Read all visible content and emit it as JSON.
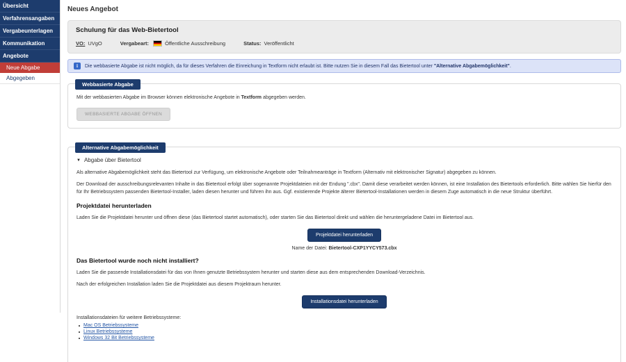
{
  "colors": {
    "navy": "#1d3c6d",
    "red": "#c13e38",
    "link": "#2456a5",
    "banner_bg": "#dce3f8",
    "banner_border": "#aebbea",
    "info_icon_bg": "#3568c9"
  },
  "icons": {
    "info_glyph": "i",
    "collapse_arrow": "▼"
  },
  "sidebar": {
    "items": [
      "Übersicht",
      "Verfahrensangaben",
      "Vergabeunterlagen",
      "Kommunikation",
      "Angebote"
    ],
    "sub_items": [
      {
        "label": "Neue Abgabe",
        "active": true
      },
      {
        "label": "Abgegeben",
        "active": false
      }
    ]
  },
  "header": {
    "page_title": "Neues Angebot",
    "procedure_title": "Schulung für das Web-Bietertool",
    "vo_label": "VO:",
    "vo_value": "UVgO",
    "vergabeart_label": "Vergabeart:",
    "vergabeart_value": "Öffentliche Ausschreibung",
    "status_label": "Status:",
    "status_value": "Veröffentlicht"
  },
  "info_banner": {
    "text_before": "Die webbasierte Abgabe ist nicht möglich, da für dieses Verfahren die Einreichung in Textform nicht erlaubt ist. Bitte nutzen Sie in diesem Fall das Bietertool unter ",
    "text_bold": "\"Alternative Abgabemöglichkeit\"",
    "text_after": "."
  },
  "web_section": {
    "badge": "Webbasierte Abgabe",
    "text_before": "Mit der webbasierten Abgabe im Browser können elektronische Angebote in ",
    "text_bold": "Textform",
    "text_after": " abgegeben werden.",
    "button_label": "WEBBASIERTE ABGABE ÖFFNEN"
  },
  "alt_section": {
    "badge": "Alternative Abgabemöglichkeit",
    "collapse_title": "Abgabe über Bietertool",
    "p1": "Als alternative Abgabemöglichkeit steht das Bietertool zur Verfügung, um elektronische Angebote oder Teilnahmeanträge in Textform (Alternativ mit elektronischer Signatur) abgegeben zu können.",
    "p2": "Der Download der ausschreibungsrelevanten Inhalte in das Bietertool erfolgt über sogenannte Projektdateien mit der Endung \".cbx\". Damit diese verarbeitet werden können, ist eine Installation des Bietertools erforderlich. Bitte wählen Sie hierfür den für Ihr Betriebssystem passenden Bietertool-Installer, laden diesen herunter und führen ihn aus. Ggf. existierende Projekte älterer Bietertool-Installationen werden in diesem Zuge automatisch in die neue Struktur überführt.",
    "project_heading": "Projektdatei herunterladen",
    "p3": "Laden Sie die Projektdatei herunter und öffnen diese (das Bietertool startet automatisch), oder starten Sie das Bietertool direkt und wählen die heruntergeladene Datei im Bietertool aus.",
    "project_button": "Projektdatei herunterladen",
    "file_label": "Name der Datei:",
    "file_name": "Bietertool-CXP1YYCY573.cbx",
    "install_heading": "Das Bietertool wurde noch nicht installiert?",
    "p4": "Laden Sie die passende Installationsdatei für das von Ihnen genutzte Betriebssystem herunter und starten diese aus dem entsprechenden Download-Verzeichnis.",
    "p5": "Nach der erfolgreichen Installation laden Sie die Projektdatei aus diesem Projektraum herunter.",
    "install_button": "Installationsdatei herunterladen",
    "other_os_label": "Installationsdateien für weitere Betriebssysteme:",
    "os_links": [
      "Mac OS Betriebssysteme",
      "Linux Betriebssysteme",
      "Windows 32 Bit Betriebssysteme"
    ]
  }
}
